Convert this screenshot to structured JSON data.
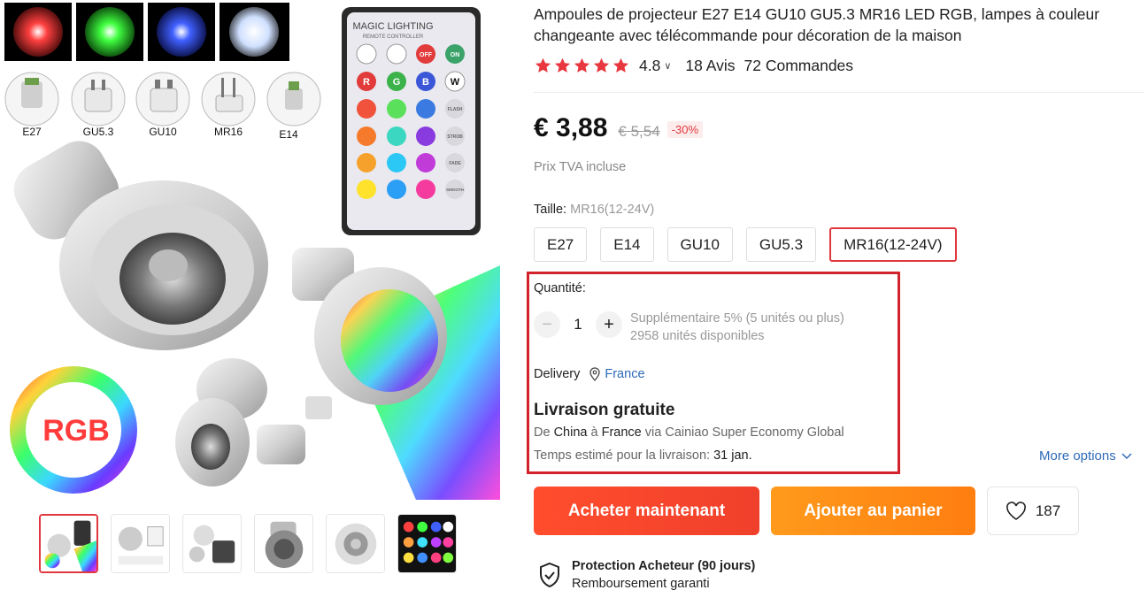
{
  "product": {
    "title": "Ampoules de projecteur E27 E14 GU10 GU5.3 MR16 LED RGB, lampes à couleur changeante avec télécommande pour décoration de la maison",
    "rating": "4.8",
    "reviews": "18 Avis",
    "orders": "72 Commandes"
  },
  "image": {
    "base_labels": [
      "E27",
      "GU5.3",
      "GU10",
      "MR16",
      "E14"
    ],
    "remote_title": "MAGIC LIGHTING",
    "remote_subtitle": "REMOTE CONTROLLER",
    "remote_keys": {
      "off": "OFF",
      "on": "ON",
      "r": "R",
      "g": "G",
      "b": "B",
      "w": "W",
      "flash": "FLASH",
      "strob": "STROB",
      "fade": "FADE",
      "smooth": "SMOOTH"
    },
    "rgb_badge": "RGB"
  },
  "price": {
    "current": "€ 3,88",
    "original": "€ 5,54",
    "discount": "-30%",
    "tax_note": "Prix TVA incluse"
  },
  "size": {
    "label": "Taille:",
    "selected": "MR16(12-24V)",
    "options": [
      "E27",
      "E14",
      "GU10",
      "GU5.3",
      "MR16(12-24V)"
    ]
  },
  "quantity": {
    "label": "Quantité:",
    "value": "1",
    "bulk_note": "Supplémentaire 5% (5 unités ou plus)",
    "stock": "2958 unités disponibles"
  },
  "delivery": {
    "label": "Delivery",
    "country": "France",
    "shipping_title": "Livraison gratuite",
    "route_from_prefix": "De",
    "route_from": "China",
    "route_to_prefix": "à",
    "route_to": "France",
    "route_via": "via Cainiao Super Economy Global",
    "eta_label": "Temps estimé pour la livraison:",
    "eta_date": "31 jan.",
    "more_options": "More options"
  },
  "actions": {
    "buy_now": "Acheter maintenant",
    "add_to_cart": "Ajouter au panier",
    "wishlist_count": "187"
  },
  "protection": {
    "title": "Protection Acheteur (90 jours)",
    "subtitle": "Remboursement garanti"
  },
  "colors": {
    "accent_red": "#e0383e",
    "buy_orange_red": "#ff4d2d",
    "cart_orange": "#ff9a1c",
    "link_blue": "#2e6ab8",
    "highlight_box": "#d2232c"
  }
}
